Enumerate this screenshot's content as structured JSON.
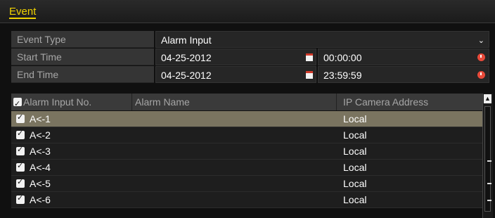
{
  "tabs": {
    "event": "Event"
  },
  "form": {
    "event_type": {
      "label": "Event Type",
      "value": "Alarm Input"
    },
    "start_time": {
      "label": "Start Time",
      "date": "04-25-2012",
      "time": "00:00:00"
    },
    "end_time": {
      "label": "End Time",
      "date": "04-25-2012",
      "time": "23:59:59"
    }
  },
  "table": {
    "columns": [
      "Alarm Input No.",
      "Alarm Name",
      "IP Camera Address"
    ],
    "rows": [
      {
        "no": "A<-1",
        "name": "",
        "ip": "Local",
        "checked": true,
        "selected": true
      },
      {
        "no": "A<-2",
        "name": "",
        "ip": "Local",
        "checked": true,
        "selected": false
      },
      {
        "no": "A<-3",
        "name": "",
        "ip": "Local",
        "checked": true,
        "selected": false
      },
      {
        "no": "A<-4",
        "name": "",
        "ip": "Local",
        "checked": true,
        "selected": false
      },
      {
        "no": "A<-5",
        "name": "",
        "ip": "Local",
        "checked": true,
        "selected": false
      },
      {
        "no": "A<-6",
        "name": "",
        "ip": "Local",
        "checked": true,
        "selected": false
      }
    ]
  },
  "colors": {
    "accent": "#f0d200",
    "selected_row": "#7a7460",
    "label_bg": "#353535",
    "field_bg": "#262626"
  },
  "icons": [
    "calendar-icon",
    "clock-icon",
    "chevron-down-icon",
    "checkbox-checked-icon",
    "scroll-up-icon"
  ]
}
